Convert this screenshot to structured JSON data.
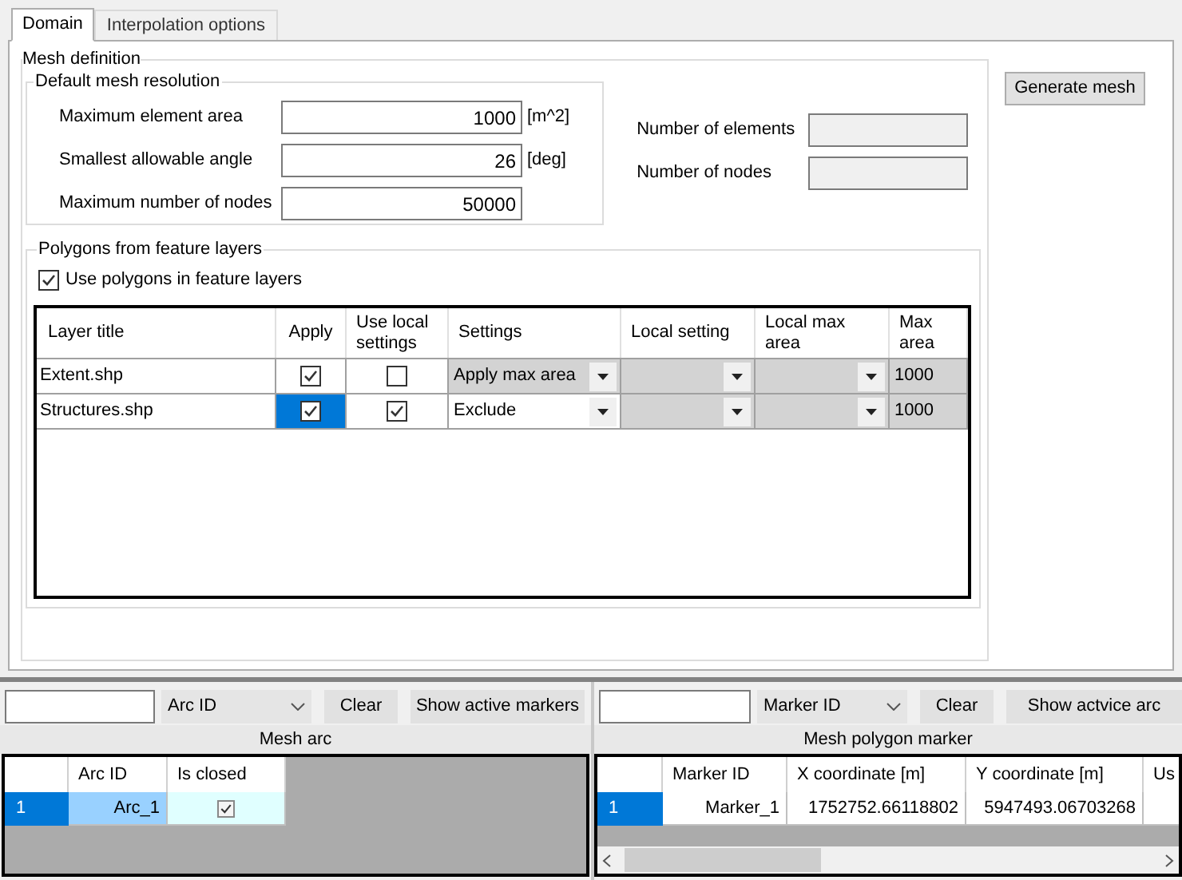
{
  "tabs": [
    {
      "label": "Domain",
      "selected": true
    },
    {
      "label": "Interpolation options",
      "selected": false
    }
  ],
  "mesh_definition": {
    "title": "Mesh definition",
    "default_resolution": {
      "title": "Default mesh resolution",
      "fields": [
        {
          "label": "Maximum element area",
          "value": "1000",
          "unit": "[m^2]"
        },
        {
          "label": "Smallest allowable angle",
          "value": "26",
          "unit": "[deg]"
        },
        {
          "label": "Maximum number of nodes",
          "value": "50000"
        }
      ]
    },
    "statistics": [
      {
        "label": "Number of elements"
      },
      {
        "label": "Number of nodes"
      }
    ],
    "polygons": {
      "title": "Polygons from feature layers",
      "use_polygons": {
        "label": "Use polygons in feature layers",
        "checked": true
      },
      "table": {
        "columns": [
          "Layer title",
          "Apply",
          "Use local settings",
          "Settings",
          "Local setting",
          "Local max area",
          "Max area"
        ],
        "rows": [
          {
            "layer_title": "Extent.shp",
            "apply": {
              "checked": true,
              "selected": false
            },
            "use_local": {
              "checked": false
            },
            "settings": {
              "value": "Apply max area",
              "disabled": true
            },
            "local_setting": {
              "disabled": true
            },
            "local_max_area": {
              "disabled": true
            },
            "max_area": "1000"
          },
          {
            "layer_title": "Structures.shp",
            "apply": {
              "checked": true,
              "selected": true
            },
            "use_local": {
              "checked": true
            },
            "settings": {
              "value": "Exclude",
              "disabled": false
            },
            "local_setting": {
              "disabled": true
            },
            "local_max_area": {
              "disabled": true
            },
            "max_area": "1000"
          }
        ]
      }
    }
  },
  "generate_button": "Generate mesh",
  "panels": [
    {
      "combo": "Arc ID",
      "clear": "Clear",
      "show": "Show active markers",
      "title": "Mesh arc",
      "columns": [
        "Arc ID",
        "Is closed"
      ],
      "rows": [
        {
          "number": "1",
          "selected": true,
          "cells": [
            {
              "kind": "text",
              "text": "Arc_1"
            },
            {
              "kind": "check",
              "checked": true
            }
          ]
        }
      ],
      "scrollbar": false
    },
    {
      "combo": "Marker ID",
      "clear": "Clear",
      "show": "Show actvice arc",
      "title": "Mesh polygon marker",
      "columns": [
        "Marker ID",
        "X coordinate [m]",
        "Y coordinate [m]",
        "Us"
      ],
      "rows": [
        {
          "number": "1",
          "selected": true,
          "cells": [
            {
              "kind": "text",
              "text": "Marker_1"
            },
            {
              "kind": "text",
              "text": "1752752.66118802"
            },
            {
              "kind": "text",
              "text": "5947493.06703268"
            },
            {
              "kind": "empty"
            }
          ]
        }
      ],
      "scrollbar": true
    }
  ]
}
